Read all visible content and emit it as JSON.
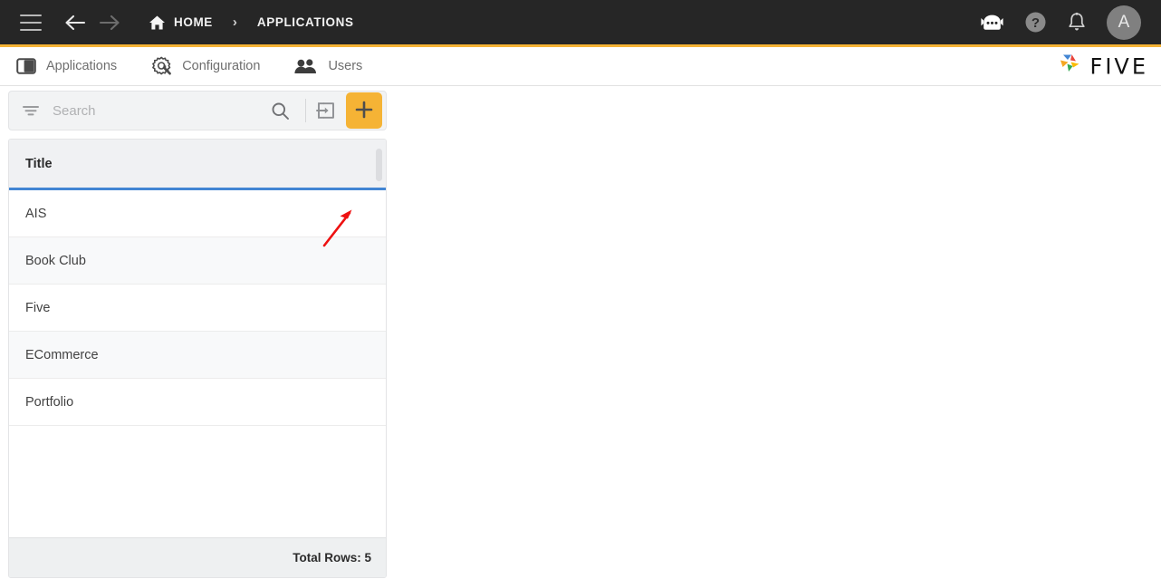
{
  "topbar": {
    "menu_icon": "hamburger-menu-icon",
    "back_icon": "arrow-back-icon",
    "forward_icon": "arrow-forward-icon",
    "breadcrumb": {
      "home_icon": "home-icon",
      "home_label": "HOME",
      "separator": "›",
      "current_label": "APPLICATIONS"
    },
    "actions": [
      {
        "name": "chatbot-icon",
        "label": ""
      },
      {
        "name": "help-icon",
        "label": "?"
      },
      {
        "name": "notifications-bell-icon",
        "label": ""
      }
    ],
    "avatar_initial": "A",
    "bg_color": "#262626",
    "accent_color": "#f5b335"
  },
  "tabs": [
    {
      "label": "Applications",
      "icon": "panels-icon",
      "active": true
    },
    {
      "label": "Configuration",
      "icon": "gear-wrench-icon",
      "active": false
    },
    {
      "label": "Users",
      "icon": "users-icon",
      "active": false
    }
  ],
  "brand": {
    "word": "FIVE",
    "logo_icon": "five-pinwheel-logo-icon",
    "colors": [
      "#4285d3",
      "#e8453c",
      "#f5a623",
      "#34a853",
      "#fbbc05"
    ]
  },
  "toolbar": {
    "filter_icon": "filter-icon",
    "search_placeholder": "Search",
    "search_value": "",
    "search_icon": "search-magnifier-icon",
    "import_icon": "import-arrow-into-box-icon",
    "add_icon": "plus-icon",
    "add_button_color": "#f5b335"
  },
  "table": {
    "columns": [
      "Title"
    ],
    "header_underline_color": "#4285d3",
    "rows": [
      {
        "title": "AIS"
      },
      {
        "title": "Book Club"
      },
      {
        "title": "Five"
      },
      {
        "title": "ECommerce"
      },
      {
        "title": "Portfolio"
      }
    ],
    "footer_label": "Total Rows: 5"
  },
  "annotation": {
    "arrow_color": "#ee1111",
    "points_to": "add-button"
  }
}
